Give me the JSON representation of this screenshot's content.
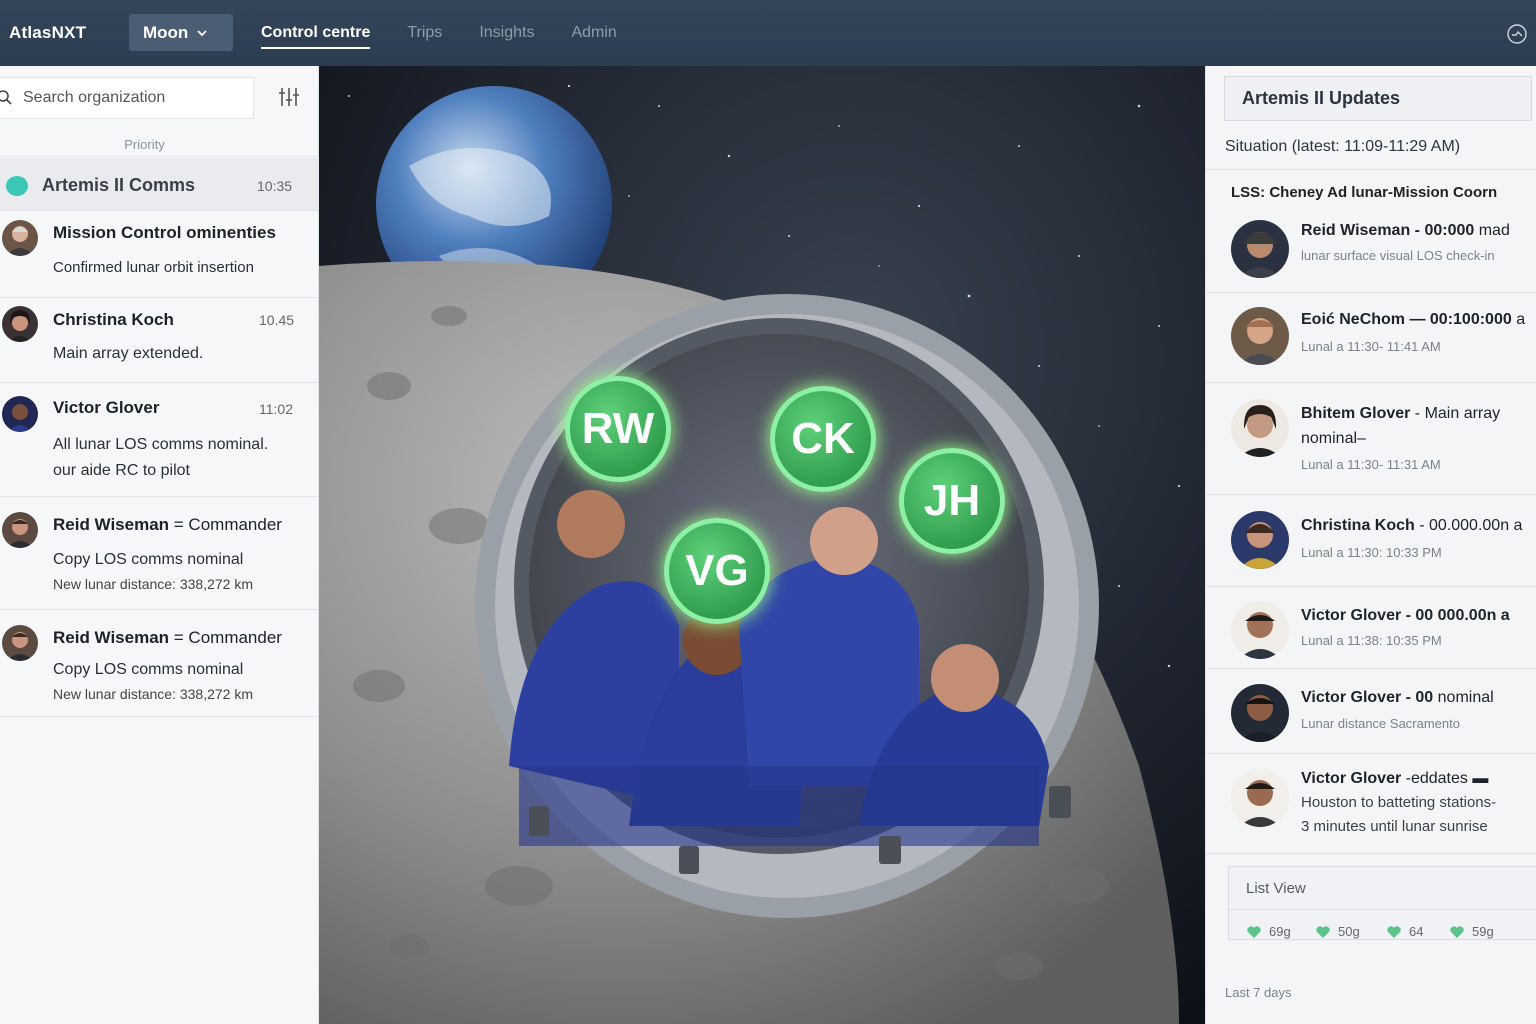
{
  "app": {
    "brand": "AtlasNXT",
    "selector": "Moon",
    "nav": [
      "Control centre",
      "Trips",
      "Insights",
      "Admin"
    ]
  },
  "left": {
    "search_placeholder": "Search organization",
    "priority_label": "Priority",
    "group": {
      "title": "Artemis II Comms",
      "time": "10:35"
    },
    "messages": [
      {
        "name": "Mission Control ominenties",
        "role": "",
        "time": "",
        "lines": [
          "Confirmed lunar orbit insertion"
        ]
      },
      {
        "name": "Christina Koch",
        "role": "",
        "time": "10.45",
        "lines": [
          "Main array extended."
        ]
      },
      {
        "name": "Victor Glover",
        "role": "",
        "time": "11:02",
        "lines": [
          "All lunar LOS comms nominal.",
          "our aide RC to pilot"
        ]
      },
      {
        "name": "Reid Wiseman",
        "role": " = Commander",
        "time": "",
        "lines": [
          "Copy LOS comms nominal",
          "New lunar distance: 338,272 km"
        ]
      },
      {
        "name": "Reid Wiseman",
        "role": " = Commander",
        "time": "",
        "lines": [
          "Copy LOS comms nominal",
          "New lunar distance: 338,272 km"
        ]
      }
    ]
  },
  "scene": {
    "markers": [
      "RW",
      "CK",
      "VG",
      "JH"
    ]
  },
  "right": {
    "header": "Artemis II Updates",
    "situation": "Situation (latest: 11:09-11:29 AM)",
    "lss": "LSS: Cheney Ad lunar-Mission Coorn",
    "updates": [
      {
        "title_bold": "Reid Wiseman - 00:000",
        "title_rest": " mad",
        "sub": "lunar surface visual LOS check-in",
        "body": []
      },
      {
        "title_bold": "Eoić NeChom — 00:100:000",
        "title_rest": " a",
        "sub": "Lunal a 11:30- 11:41 AM",
        "body": []
      },
      {
        "title_bold": "Bhitem Glover",
        "title_rest": " - Main array nominal–",
        "sub": "Lunal a 11:30- 11:31 AM",
        "body": []
      },
      {
        "title_bold": "Christina Koch",
        "title_rest": " - 00.000.00n a",
        "sub": "Lunal a 11:30: 10:33 PM",
        "body": []
      },
      {
        "title_bold": "Victor Glover - 00 000.00n a",
        "title_rest": "",
        "sub": "Lunal a 11:38: 10:35 PM",
        "body": []
      },
      {
        "title_bold": "Victor Glover - 00",
        "title_rest": " nominal",
        "sub": "Lunar distance Sacramento",
        "body": []
      },
      {
        "title_bold": "Victor Glover",
        "title_rest": " -eddates ▬",
        "sub": "",
        "body": [
          "Houston to batteting stations-",
          "3 minutes until lunar sunrise"
        ]
      }
    ],
    "list_view": {
      "title": "List View",
      "chips": [
        "69g",
        "50g",
        "64",
        "59g"
      ]
    },
    "footer": "Last 7 days"
  }
}
